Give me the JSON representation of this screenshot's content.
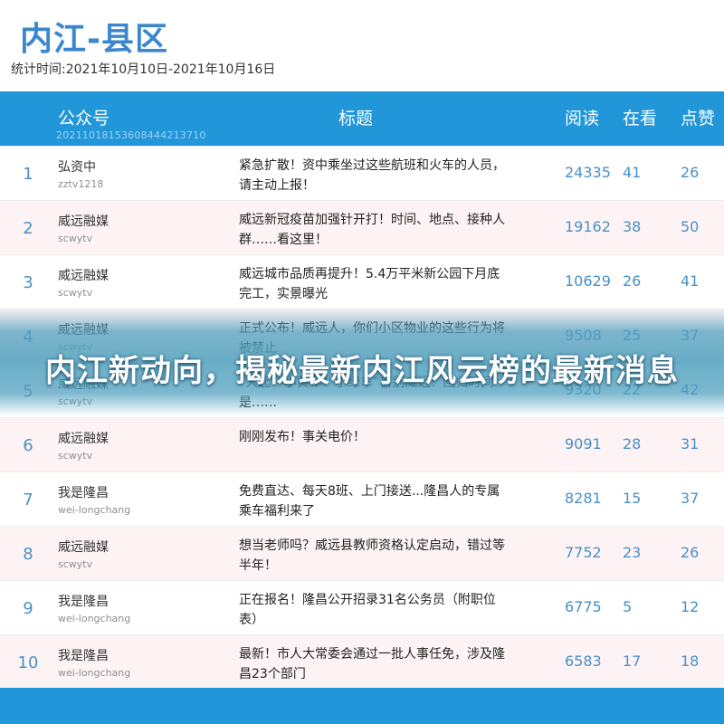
{
  "header": {
    "title": "内江-县区",
    "period": "统计时间:2021年10月10日-2021年10月16日"
  },
  "table": {
    "columns": {
      "account": "公众号",
      "title": "标题",
      "reads": "阅读",
      "watching": "在看",
      "likes": "点赞"
    },
    "header_id": "20211018153608444213710",
    "rows": [
      {
        "rank": "1",
        "name": "弘资中",
        "account": "zztv1218",
        "title": "紧急扩散！资中乘坐过这些航班和火车的人员，请主动上报！",
        "reads": "24335",
        "watching": "41",
        "likes": "26"
      },
      {
        "rank": "2",
        "name": "威远融媒",
        "account": "scwytv",
        "title": "威远新冠疫苗加强针开打！时间、地点、接种人群……看这里！",
        "reads": "19162",
        "watching": "38",
        "likes": "50"
      },
      {
        "rank": "3",
        "name": "威远融媒",
        "account": "scwytv",
        "title": "威远城市品质再提升！5.4万平米新公园下月底完工，实景曝光",
        "reads": "10629",
        "watching": "26",
        "likes": "41"
      },
      {
        "rank": "4",
        "name": "威远融媒",
        "account": "scwytv",
        "title": "正式公布！威远人，你们小区物业的这些行为将被禁止",
        "reads": "9508",
        "watching": "25",
        "likes": "37"
      },
      {
        "rank": "5",
        "name": "威远融媒",
        "account": "scwytv",
        "title": "“大起”“小黄车”“小绿车”首别威远！回归时间是……",
        "reads": "9320",
        "watching": "22",
        "likes": "42"
      },
      {
        "rank": "6",
        "name": "威远融媒",
        "account": "scwytv",
        "title": "刚刚发布！事关电价！",
        "reads": "9091",
        "watching": "28",
        "likes": "31"
      },
      {
        "rank": "7",
        "name": "我是隆昌",
        "account": "wei-longchang",
        "title": "免费直达、每天8班、上门接送...隆昌人的专属乘车福利来了",
        "reads": "8281",
        "watching": "15",
        "likes": "37"
      },
      {
        "rank": "8",
        "name": "威远融媒",
        "account": "scwytv",
        "title": "想当老师吗？威远县教师资格认定启动，错过等半年！",
        "reads": "7752",
        "watching": "23",
        "likes": "26"
      },
      {
        "rank": "9",
        "name": "我是隆昌",
        "account": "wei-longchang",
        "title": "正在报名！隆昌公开招录31名公务员（附职位表）",
        "reads": "6775",
        "watching": "5",
        "likes": "12"
      },
      {
        "rank": "10",
        "name": "我是隆昌",
        "account": "wei-longchang",
        "title": "最新！市人大常委会通过一批人事任免，涉及隆昌23个部门",
        "reads": "6583",
        "watching": "17",
        "likes": "18"
      }
    ]
  },
  "banner": {
    "text": "内江新动向，揭秘最新内江风云榜的最新消息"
  },
  "colors": {
    "accent": "#2196d8",
    "title": "#3a87cf",
    "number": "#4a90c8",
    "alt_row": "#fdf3f4"
  }
}
